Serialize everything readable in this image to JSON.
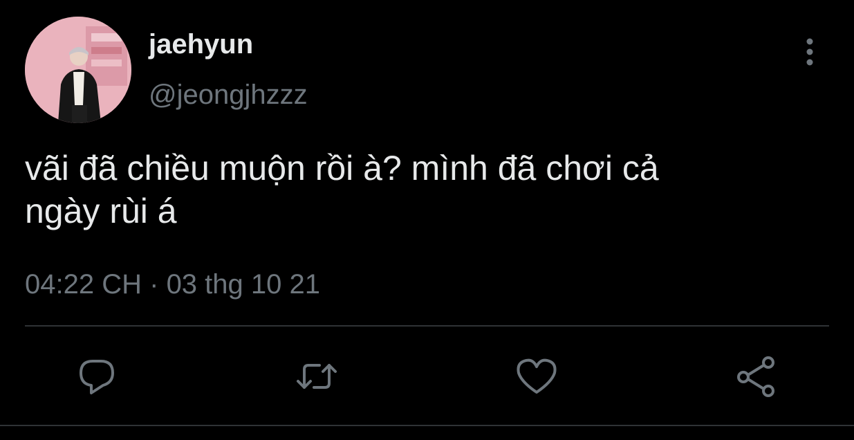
{
  "user": {
    "display_name": "jaehyun",
    "handle": "@jeongjhzzz",
    "avatar_icon": "profile-photo"
  },
  "tweet": {
    "text": "vãi đã chiều muộn rồi à? mình đã chơi cả\nngày rùi á",
    "time": "04:22 CH",
    "separator": "·",
    "date": "03 thg 10 21"
  },
  "actions": [
    {
      "name": "reply",
      "icon": "comment-icon"
    },
    {
      "name": "retweet",
      "icon": "retweet-icon"
    },
    {
      "name": "like",
      "icon": "heart-icon"
    },
    {
      "name": "share",
      "icon": "share-icon"
    }
  ],
  "colors": {
    "background": "#000000",
    "primary_text": "#e7e9ea",
    "secondary_text": "#6e767d",
    "divider": "#2f3336",
    "icon": "#6e767d"
  }
}
